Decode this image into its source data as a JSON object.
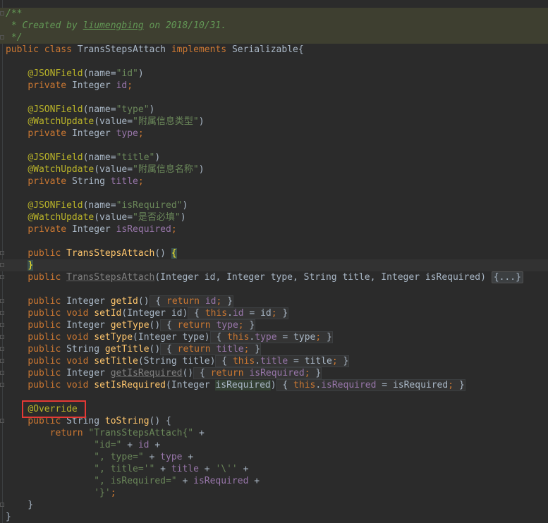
{
  "doc": {
    "open": "/**",
    "author_prefix": " * Created by ",
    "author": "liumengbing",
    "author_suffix": " on 2018/10/31.",
    "close": " */"
  },
  "class_decl": {
    "kw_public": "public",
    "kw_class": "class",
    "name": "TransStepsAttach",
    "kw_implements": "implements",
    "iface": "Serializable",
    "open": "{"
  },
  "fields": [
    {
      "json_name": "id",
      "watch_value": "",
      "type": "Integer",
      "name": "id"
    },
    {
      "json_name": "type",
      "watch_value": "附属信息类型",
      "type": "Integer",
      "name": "type"
    },
    {
      "json_name": "title",
      "watch_value": "附属信息名称",
      "type": "String",
      "name": "title"
    },
    {
      "json_name": "isRequired",
      "watch_value": "是否必填",
      "type": "Integer",
      "name": "isRequired"
    }
  ],
  "tokens": {
    "json_field": "@JSONField",
    "watch_update": "@WatchUpdate",
    "private": "private",
    "public": "public",
    "void": "void",
    "return": "return",
    "this": "this",
    "override": "@Override",
    "fold_placeholder": "{...}"
  },
  "ctor": {
    "name": "TransStepsAttach",
    "params": "Integer id, Integer type, String title, Integer isRequired"
  },
  "accessors": [
    {
      "ret": "Integer",
      "name": "getId",
      "params": "",
      "body": "return id;"
    },
    {
      "ret": "void",
      "name": "setId",
      "params": "Integer id",
      "body": "this.id = id;"
    },
    {
      "ret": "Integer",
      "name": "getType",
      "params": "",
      "body": "return type;"
    },
    {
      "ret": "void",
      "name": "setType",
      "params": "Integer type",
      "body": "this.type = type;"
    },
    {
      "ret": "String",
      "name": "getTitle",
      "params": "",
      "body": "return title;"
    },
    {
      "ret": "void",
      "name": "setTitle",
      "params": "String title",
      "body": "this.title = title;"
    },
    {
      "ret": "Integer",
      "name": "getIsRequired",
      "params": "",
      "body": "return isRequired;"
    },
    {
      "ret": "void",
      "name": "setIsRequired",
      "params": "Integer isRequired",
      "body": "this.isRequired = isRequired;"
    }
  ],
  "tostring": {
    "ret": "String",
    "name": "toString",
    "str_head": "\"TransStepsAttach{\"",
    "str_id": "\"id=\"",
    "str_type": "\", type=\"",
    "str_title": "\", title='\"",
    "str_quote": "'\\''",
    "str_isreq": "\", isRequired=\"",
    "str_close": "'}'"
  },
  "colors": {
    "background": "#2b2b2b",
    "keyword": "#cc7832",
    "annotation": "#bbb529",
    "string": "#6a8759",
    "field": "#9876aa",
    "method": "#ffc66d",
    "highlight_box": "#e53935"
  }
}
